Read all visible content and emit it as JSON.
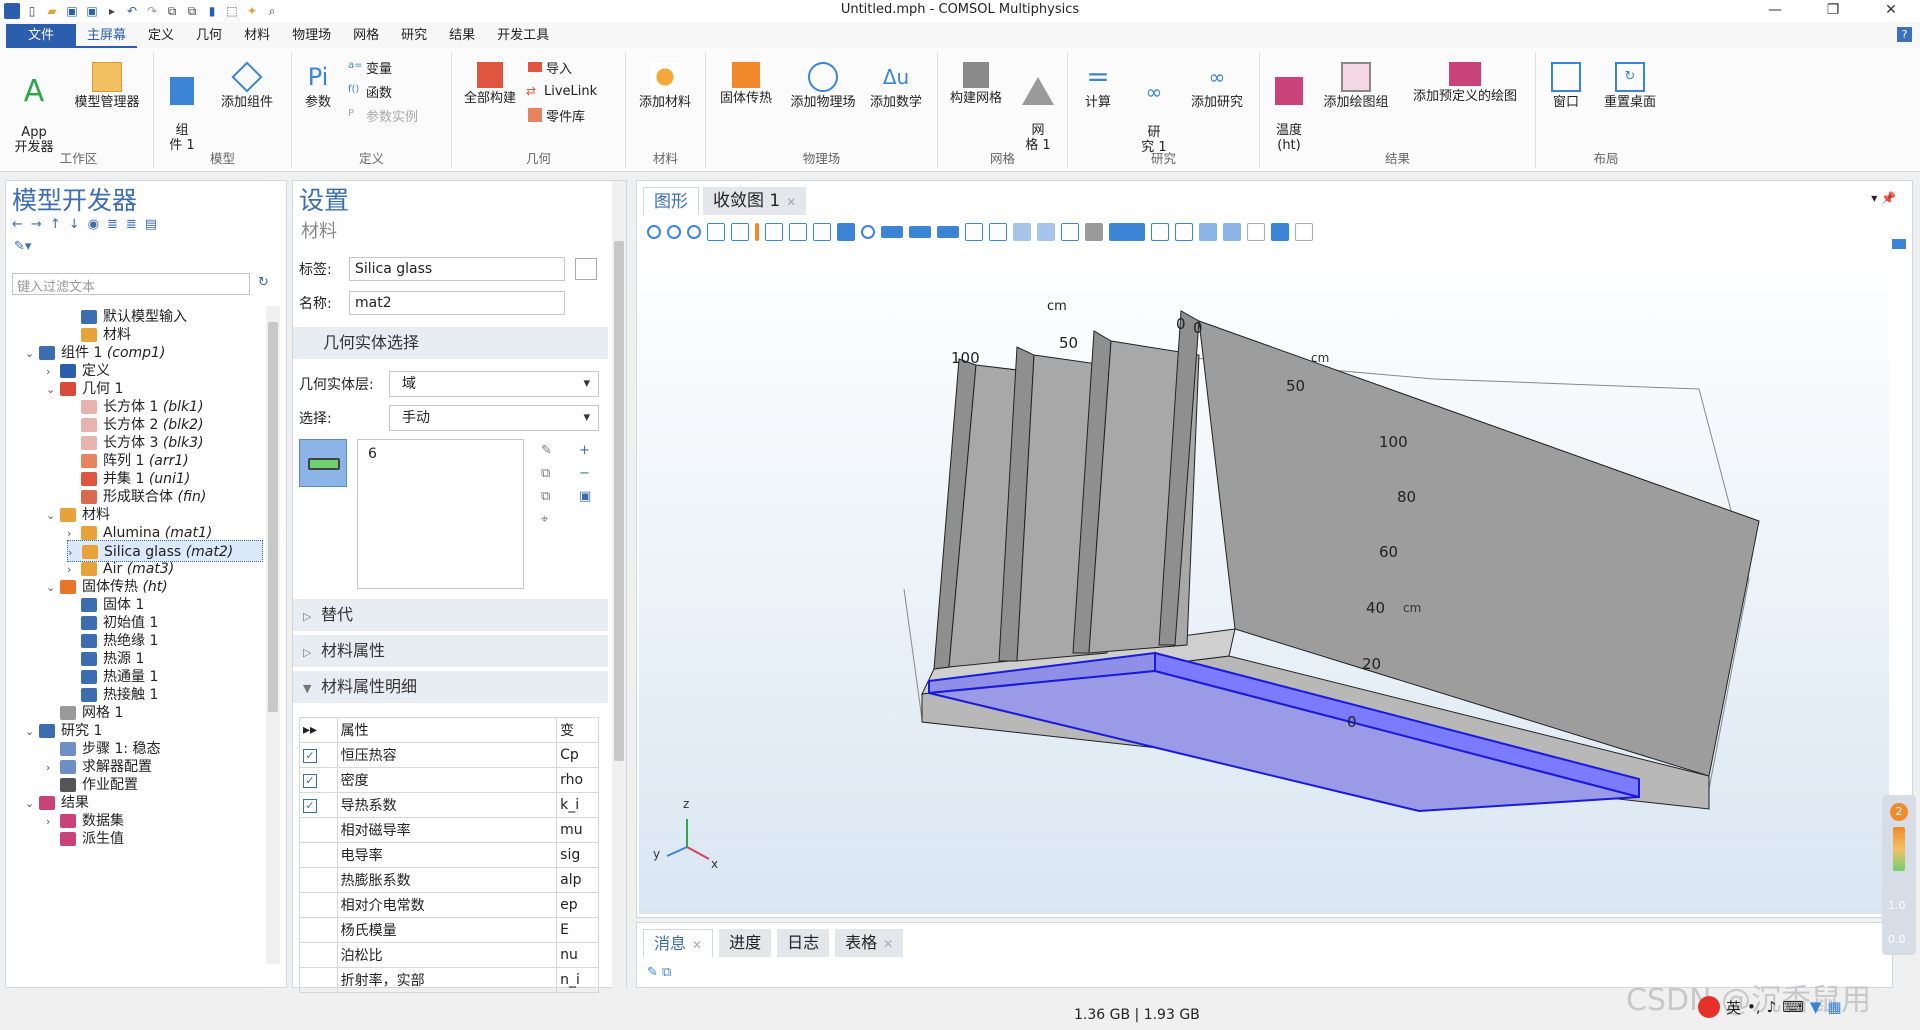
{
  "window": {
    "title": "Untitled.mph - COMSOL Multiphysics"
  },
  "menu": {
    "file": "文件",
    "items": [
      "主屏幕",
      "定义",
      "几何",
      "材料",
      "物理场",
      "网格",
      "研究",
      "结果",
      "开发工具"
    ],
    "help": "?"
  },
  "ribbon": {
    "groups": {
      "workspace": "工作区",
      "model": "模型",
      "definitions": "定义",
      "geometry": "几何",
      "materials": "材料",
      "physics": "物理场",
      "mesh": "网格",
      "study": "研究",
      "results": "结果",
      "layout": "布局"
    },
    "buttons": {
      "app_developer": "App\n开发器",
      "model_manager": "模型管理器",
      "component": "组\n件 1",
      "add_component": "添加组件",
      "parameters": "参数",
      "variables": "变量",
      "functions": "函数",
      "param_cases": "参数实例",
      "build_all": "全部构建",
      "import": "导入",
      "livelink": "LiveLink",
      "parts": "零件库",
      "add_material": "添加材料",
      "heat_transfer": "固体传热",
      "add_physics": "添加物理场",
      "add_math": "添加数学",
      "build_mesh": "构建网格",
      "mesh1": "网\n格 1",
      "compute": "计算",
      "study1": "研\n究 1",
      "add_study": "添加研究",
      "temperature": "温度\n(ht)",
      "add_plot_group": "添加绘图组",
      "add_predefined_plot": "添加预定义的绘图",
      "windows": "窗口",
      "reset_desktop": "重置桌面"
    }
  },
  "model_builder": {
    "title": "模型开发器",
    "filter_placeholder": "键入过滤文本",
    "tree": [
      {
        "label": "默认模型输入",
        "tag": "",
        "indent": 3,
        "twisty": "",
        "color": "#3c6db0"
      },
      {
        "label": "材料",
        "tag": "",
        "indent": 3,
        "twisty": "",
        "color": "#e8a23a"
      },
      {
        "label": "组件 1 ",
        "tag": "(comp1)",
        "indent": 1,
        "twisty": "⌄",
        "color": "#3c6db0"
      },
      {
        "label": "定义",
        "tag": "",
        "indent": 2,
        "twisty": "›",
        "color": "#2b5fae"
      },
      {
        "label": "几何 1",
        "tag": "",
        "indent": 2,
        "twisty": "⌄",
        "color": "#d84a3a"
      },
      {
        "label": "长方体 1 ",
        "tag": "(blk1)",
        "indent": 3,
        "twisty": "",
        "color": "#e7b3ae"
      },
      {
        "label": "长方体 2 ",
        "tag": "(blk2)",
        "indent": 3,
        "twisty": "",
        "color": "#e7b3ae"
      },
      {
        "label": "长方体 3 ",
        "tag": "(blk3)",
        "indent": 3,
        "twisty": "",
        "color": "#e7b3ae"
      },
      {
        "label": "阵列 1 ",
        "tag": "(arr1)",
        "indent": 3,
        "twisty": "",
        "color": "#e7845f"
      },
      {
        "label": "并集 1 ",
        "tag": "(uni1)",
        "indent": 3,
        "twisty": "",
        "color": "#e0553f"
      },
      {
        "label": "形成联合体 ",
        "tag": "(fin)",
        "indent": 3,
        "twisty": "",
        "color": "#d86b4e"
      },
      {
        "label": "材料",
        "tag": "",
        "indent": 2,
        "twisty": "⌄",
        "color": "#e8a23a"
      },
      {
        "label": "Alumina ",
        "tag": "(mat1)",
        "indent": 3,
        "twisty": "›",
        "color": "#e8a23a"
      },
      {
        "label": "Silica glass ",
        "tag": "(mat2)",
        "indent": 3,
        "twisty": "›",
        "color": "#e8a23a",
        "selected": true
      },
      {
        "label": "Air ",
        "tag": "(mat3)",
        "indent": 3,
        "twisty": "›",
        "color": "#e8a23a"
      },
      {
        "label": "固体传热 ",
        "tag": "(ht)",
        "indent": 2,
        "twisty": "⌄",
        "color": "#e8752a"
      },
      {
        "label": "固体 1",
        "tag": "",
        "indent": 3,
        "twisty": "",
        "color": "#3c6db0"
      },
      {
        "label": "初始值 1",
        "tag": "",
        "indent": 3,
        "twisty": "",
        "color": "#3c6db0"
      },
      {
        "label": "热绝缘 1",
        "tag": "",
        "indent": 3,
        "twisty": "",
        "color": "#3c6db0"
      },
      {
        "label": "热源 1",
        "tag": "",
        "indent": 3,
        "twisty": "",
        "color": "#3c6db0"
      },
      {
        "label": "热通量 1",
        "tag": "",
        "indent": 3,
        "twisty": "",
        "color": "#3c6db0"
      },
      {
        "label": "热接触 1",
        "tag": "",
        "indent": 3,
        "twisty": "",
        "color": "#3c6db0"
      },
      {
        "label": "网格 1",
        "tag": "",
        "indent": 2,
        "twisty": "",
        "color": "#9a9a9a"
      },
      {
        "label": "研究 1",
        "tag": "",
        "indent": 1,
        "twisty": "⌄",
        "color": "#3c6db0"
      },
      {
        "label": "步骤 1: 稳态",
        "tag": "",
        "indent": 2,
        "twisty": "",
        "color": "#6d8fc4"
      },
      {
        "label": "求解器配置",
        "tag": "",
        "indent": 2,
        "twisty": "›",
        "color": "#6d8fc4"
      },
      {
        "label": "作业配置",
        "tag": "",
        "indent": 2,
        "twisty": "",
        "color": "#555"
      },
      {
        "label": "结果",
        "tag": "",
        "indent": 1,
        "twisty": "⌄",
        "color": "#c9427a"
      },
      {
        "label": "数据集",
        "tag": "",
        "indent": 2,
        "twisty": "›",
        "color": "#c9427a"
      },
      {
        "label": "派生值",
        "tag": "",
        "indent": 2,
        "twisty": "",
        "color": "#c9427a"
      }
    ]
  },
  "settings": {
    "title": "设置",
    "subtitle": "材料",
    "label_label": "标签:",
    "label_value": "Silica glass",
    "name_label": "名称:",
    "name_value": "mat2",
    "geom_section": "几何实体选择",
    "geom_level_label": "几何实体层:",
    "geom_level_value": "域",
    "selection_label": "选择:",
    "selection_value": "手动",
    "selection_list": "6",
    "override_section": "替代",
    "mat_props_section": "材料属性",
    "mat_contents_section": "材料属性明细",
    "table_header_prop": "属性",
    "table_header_var": "变",
    "rows": [
      {
        "checked": true,
        "prop": "恒压热容",
        "var": "Cp"
      },
      {
        "checked": true,
        "prop": "密度",
        "var": "rho"
      },
      {
        "checked": true,
        "prop": "导热系数",
        "var": "k_i"
      },
      {
        "checked": false,
        "prop": "相对磁导率",
        "var": "mu"
      },
      {
        "checked": false,
        "prop": "电导率",
        "var": "sig"
      },
      {
        "checked": false,
        "prop": "热膨胀系数",
        "var": "alp"
      },
      {
        "checked": false,
        "prop": "相对介电常数",
        "var": "ep"
      },
      {
        "checked": false,
        "prop": "杨氏模量",
        "var": "E"
      },
      {
        "checked": false,
        "prop": "泊松比",
        "var": "nu"
      },
      {
        "checked": false,
        "prop": "折射率，实部",
        "var": "n_i"
      }
    ]
  },
  "graphics": {
    "tabs": [
      "图形",
      "收敛图 1"
    ],
    "axes": {
      "unit": "cm",
      "x_ticks": [
        "100",
        "50",
        "0"
      ],
      "y_ticks": [
        "0",
        "50",
        "100"
      ],
      "z_ticks": [
        "0",
        "20",
        "40",
        "60",
        "80"
      ],
      "triad": {
        "x": "x",
        "y": "y",
        "z": "z"
      }
    },
    "colors": {
      "fin": "#9d9d9d",
      "selection": "#7b7bff",
      "selection_edge": "#1a1ad8"
    }
  },
  "bottom_tabs": [
    "消息",
    "进度",
    "日志",
    "表格"
  ],
  "status": {
    "memory": "1.36 GB | 1.93 GB"
  },
  "legend": {
    "badge": "2",
    "top": "1.0",
    "bottom": "0.0"
  },
  "watermark": "CSDN @沉香鼠用",
  "ime": "英"
}
